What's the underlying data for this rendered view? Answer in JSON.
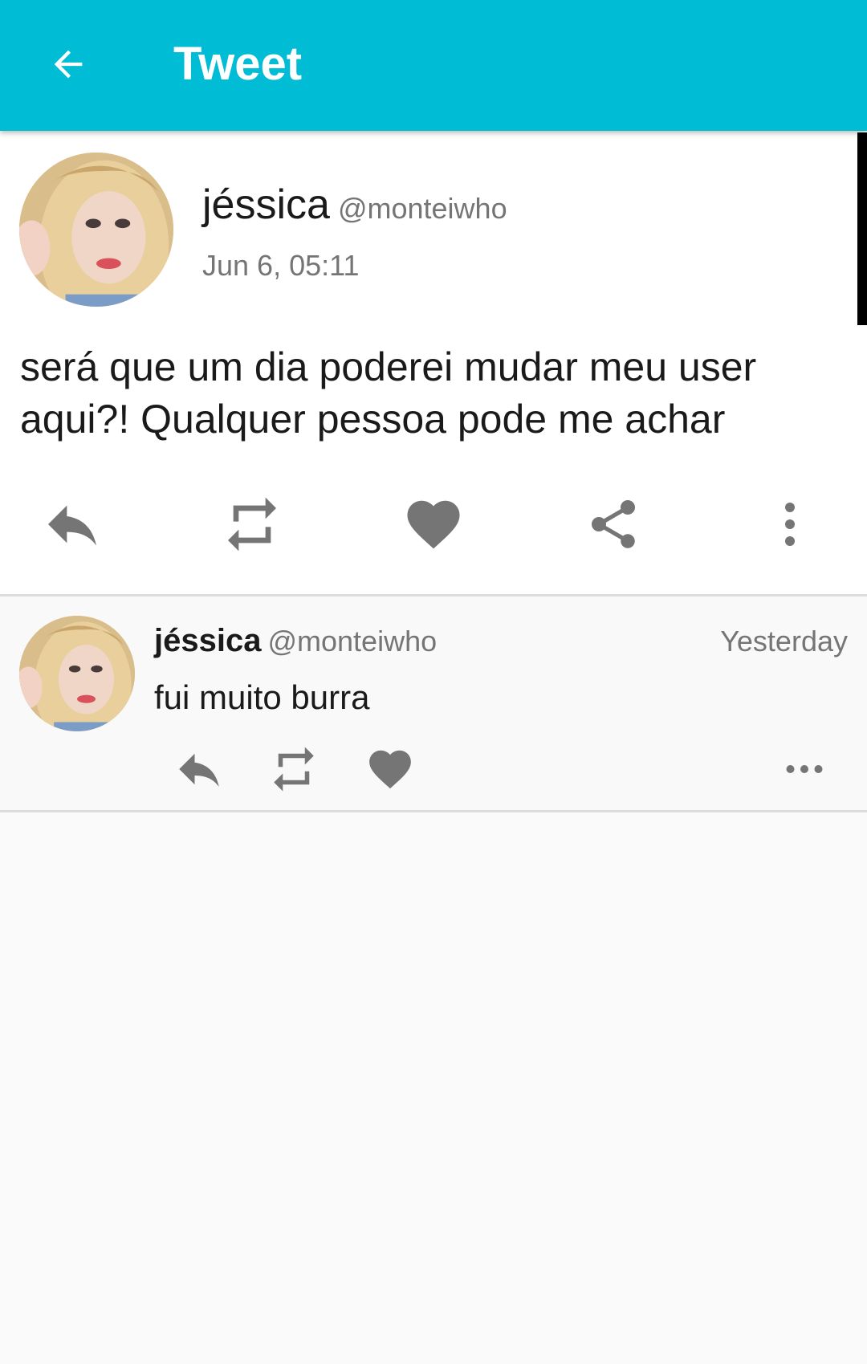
{
  "appbar": {
    "title": "Tweet"
  },
  "main_tweet": {
    "name": "jéssica",
    "handle": "@monteiwho",
    "timestamp": "Jun 6, 05:11",
    "text": "será que um dia poderei mudar meu user aqui?! Qualquer pessoa pode me achar",
    "actions": [
      "reply-icon",
      "retweet-icon",
      "like-icon",
      "share-icon",
      "more-vertical-icon"
    ]
  },
  "reply_tweet": {
    "name": "jéssica",
    "handle": "@monteiwho",
    "timestamp": "Yesterday",
    "text": "fui muito burra",
    "actions": [
      "reply-icon",
      "retweet-icon",
      "like-icon",
      "more-horizontal-icon"
    ]
  },
  "colors": {
    "accent": "#00bcd4",
    "icon": "#757575",
    "text": "#1a1a1a",
    "secondary_text": "#757575"
  }
}
